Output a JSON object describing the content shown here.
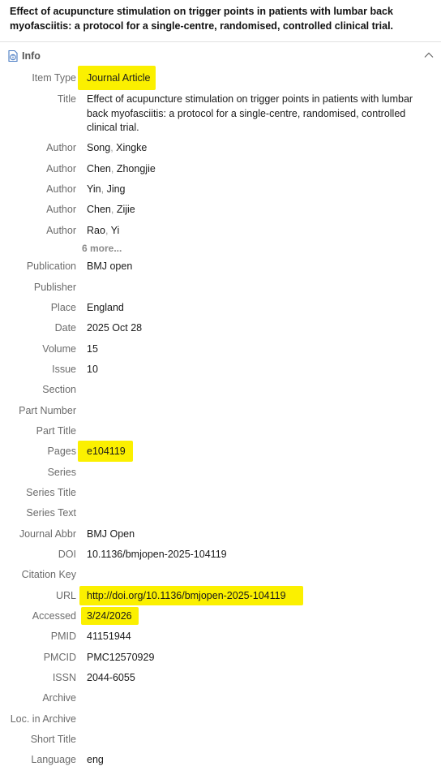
{
  "item": {
    "title": "Effect of acupuncture stimulation on trigger points in patients with lumbar back myofasciitis: a protocol for a single-centre, randomised, controlled clinical  trial."
  },
  "section": {
    "label": "Info",
    "icon": "info-document-icon",
    "collapse_icon": "chevron-up-icon"
  },
  "fields": {
    "item_type": {
      "label": "Item Type",
      "value": "Journal Article"
    },
    "title": {
      "label": "Title",
      "value": "Effect of acupuncture stimulation on trigger points in patients with lumbar back myofasciitis: a protocol for a single-centre, randomised, controlled clinical  trial."
    },
    "authors": [
      {
        "label": "Author",
        "last": "Song",
        "first": "Xingke"
      },
      {
        "label": "Author",
        "last": "Chen",
        "first": "Zhongjie"
      },
      {
        "label": "Author",
        "last": "Yin",
        "first": "Jing"
      },
      {
        "label": "Author",
        "last": "Chen",
        "first": "Zijie"
      },
      {
        "label": "Author",
        "last": "Rao",
        "first": "Yi"
      }
    ],
    "more_authors": "6 more...",
    "publication": {
      "label": "Publication",
      "value": "BMJ open"
    },
    "publisher": {
      "label": "Publisher",
      "value": ""
    },
    "place": {
      "label": "Place",
      "value": "England"
    },
    "date": {
      "label": "Date",
      "value": "2025 Oct 28"
    },
    "volume": {
      "label": "Volume",
      "value": "15"
    },
    "issue": {
      "label": "Issue",
      "value": "10"
    },
    "section": {
      "label": "Section",
      "value": ""
    },
    "part_number": {
      "label": "Part Number",
      "value": ""
    },
    "part_title": {
      "label": "Part Title",
      "value": ""
    },
    "pages": {
      "label": "Pages",
      "value": "e104119"
    },
    "series": {
      "label": "Series",
      "value": ""
    },
    "series_title": {
      "label": "Series Title",
      "value": ""
    },
    "series_text": {
      "label": "Series Text",
      "value": ""
    },
    "journal_abbr": {
      "label": "Journal Abbr",
      "value": "BMJ Open"
    },
    "doi": {
      "label": "DOI",
      "value": "10.1136/bmjopen-2025-104119"
    },
    "citation_key": {
      "label": "Citation Key",
      "value": ""
    },
    "url": {
      "label": "URL",
      "value": "http://doi.org/10.1136/bmjopen-2025-104119"
    },
    "accessed": {
      "label": "Accessed",
      "value": "3/24/2026"
    },
    "pmid": {
      "label": "PMID",
      "value": "41151944"
    },
    "pmcid": {
      "label": "PMCID",
      "value": "PMC12570929"
    },
    "issn": {
      "label": "ISSN",
      "value": "2044-6055"
    },
    "archive": {
      "label": "Archive",
      "value": ""
    },
    "loc_in_archive": {
      "label": "Loc. in Archive",
      "value": ""
    },
    "short_title": {
      "label": "Short Title",
      "value": ""
    },
    "language": {
      "label": "Language",
      "value": "eng"
    }
  },
  "colors": {
    "highlight": "#fbf000",
    "label": "#6b6b6b",
    "value": "#1a1a1a"
  }
}
